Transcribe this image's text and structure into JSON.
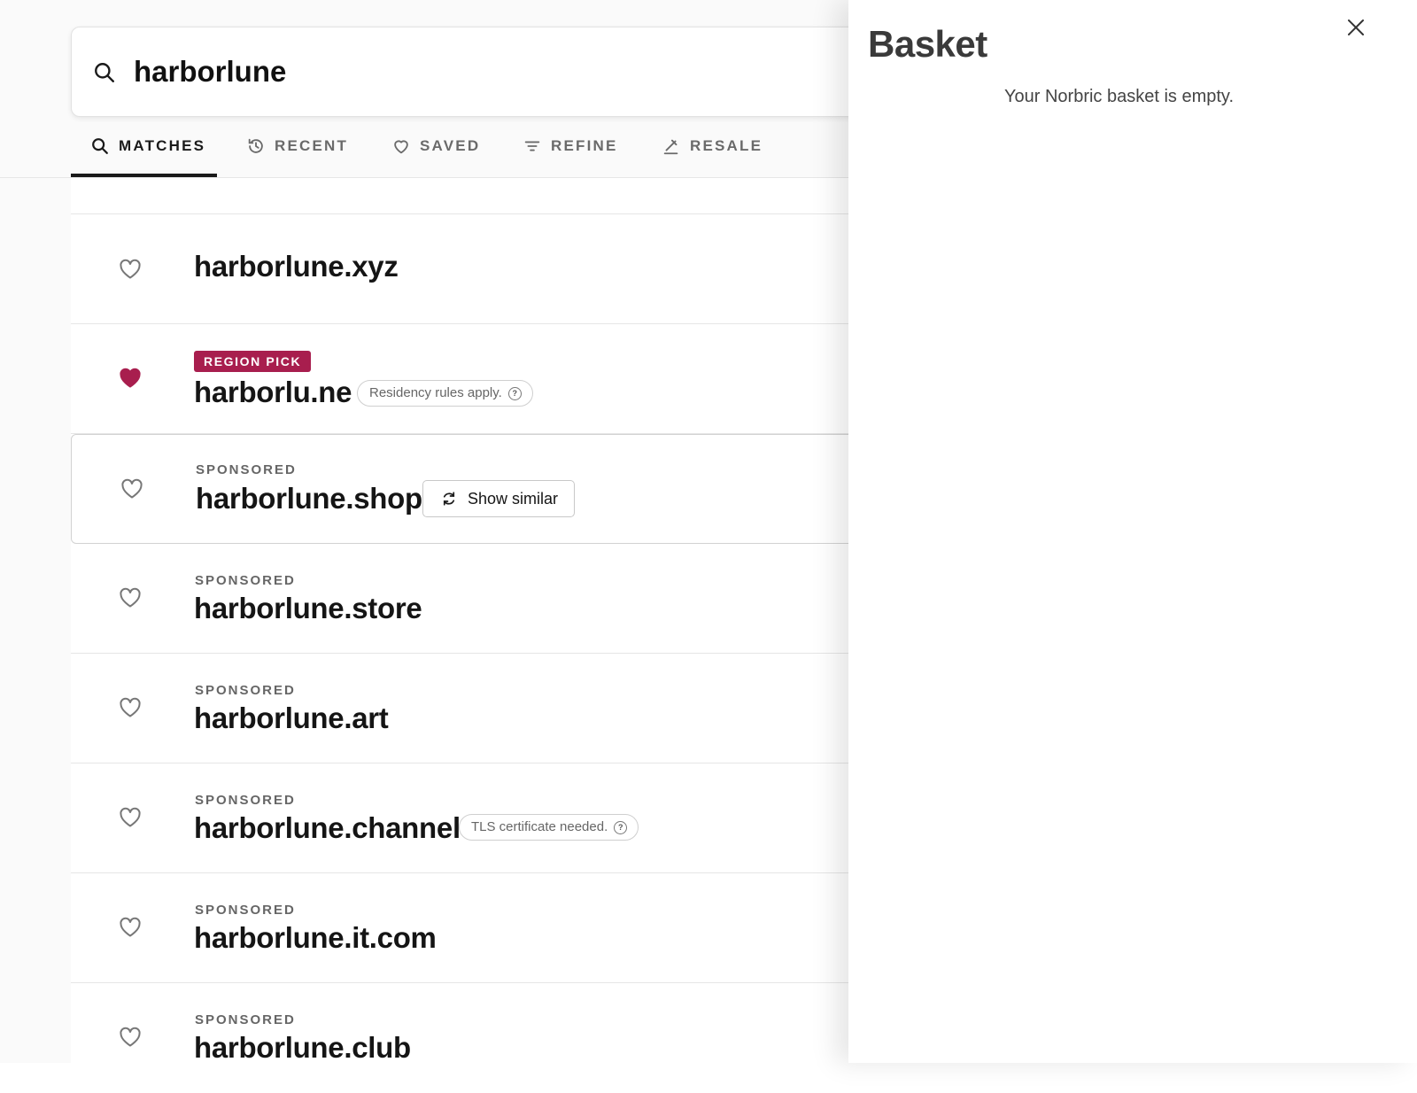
{
  "search": {
    "query": "harborlune"
  },
  "tabs": [
    {
      "label": "MATCHES",
      "icon": "search-icon",
      "active": true
    },
    {
      "label": "RECENT",
      "icon": "history-icon",
      "active": false
    },
    {
      "label": "SAVED",
      "icon": "heart-icon",
      "active": false
    },
    {
      "label": "REFINE",
      "icon": "filter-icon",
      "active": false
    },
    {
      "label": "RESALE",
      "icon": "gavel-icon",
      "active": false
    }
  ],
  "results": [
    {
      "domain": "harborlune.xyz",
      "saved": false
    },
    {
      "domain": "harborlu.ne",
      "badge": "REGION PICK",
      "note": "Residency rules apply.",
      "saved": true
    },
    {
      "domain": "harborlune.shop",
      "label": "SPONSORED",
      "action": "Show similar",
      "saved": false
    },
    {
      "domain": "harborlune.store",
      "label": "SPONSORED",
      "saved": false
    },
    {
      "domain": "harborlune.art",
      "label": "SPONSORED",
      "saved": false
    },
    {
      "domain": "harborlune.channel",
      "label": "SPONSORED",
      "note": "TLS certificate needed.",
      "saved": false
    },
    {
      "domain": "harborlune.it.com",
      "label": "SPONSORED",
      "saved": false
    },
    {
      "domain": "harborlune.club",
      "label": "SPONSORED",
      "saved": false
    }
  ],
  "basket": {
    "title": "Basket",
    "empty_message": "Your Norbric basket is empty."
  },
  "colors": {
    "accent": "#a81e4e",
    "text": "#1a1a1a",
    "muted": "#666666"
  }
}
